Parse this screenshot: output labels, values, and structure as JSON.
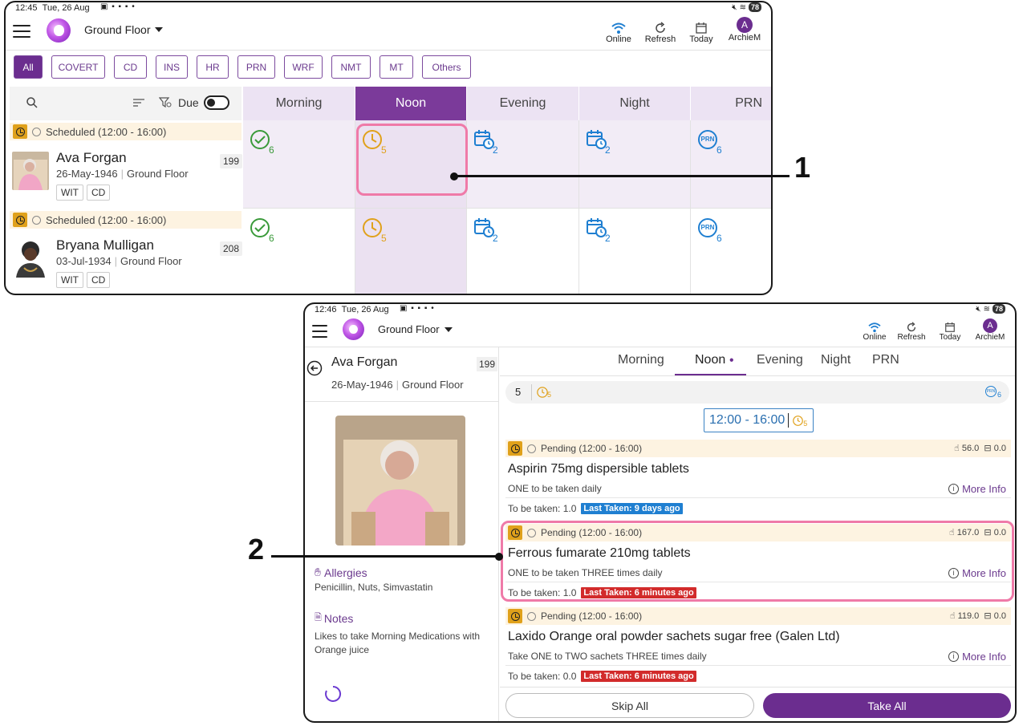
{
  "screen1": {
    "status": {
      "time": "12:45",
      "date": "Tue, 26 Aug",
      "battery": "78"
    },
    "header": {
      "floor": "Ground Floor",
      "actions": [
        {
          "label": "Online"
        },
        {
          "label": "Refresh"
        },
        {
          "label": "Today"
        },
        {
          "label": "ArchieM",
          "initial": "A"
        }
      ]
    },
    "filters": [
      "All",
      "COVERT",
      "CD",
      "INS",
      "HR",
      "PRN",
      "WRF",
      "NMT",
      "MT",
      "Others"
    ],
    "toolbar": {
      "due_label": "Due"
    },
    "columns": [
      "Morning",
      "Noon",
      "Evening",
      "Night",
      "PRN"
    ],
    "patients": [
      {
        "schedule": "Scheduled (12:00 - 16:00)",
        "name": "Ava Forgan",
        "dob": "26-May-1946",
        "floor": "Ground Floor",
        "room": "199",
        "tags": [
          "WIT",
          "CD"
        ],
        "counts": [
          "6",
          "5",
          "2",
          "2",
          "6"
        ]
      },
      {
        "schedule": "Scheduled (12:00 - 16:00)",
        "name": "Bryana Mulligan",
        "dob": "03-Jul-1934",
        "floor": "Ground Floor",
        "room": "208",
        "tags": [
          "WIT",
          "CD"
        ],
        "counts": [
          "6",
          "5",
          "2",
          "2",
          "6"
        ]
      }
    ],
    "prn_icon_text": "PRN",
    "annotation": "1"
  },
  "screen2": {
    "status": {
      "time": "12:46",
      "date": "Tue, 26 Aug",
      "battery": "78"
    },
    "header": {
      "floor": "Ground Floor",
      "actions": [
        {
          "label": "Online"
        },
        {
          "label": "Refresh"
        },
        {
          "label": "Today"
        },
        {
          "label": "ArchieM",
          "initial": "A"
        }
      ]
    },
    "patient": {
      "name": "Ava Forgan",
      "room": "199",
      "dob": "26-May-1946",
      "floor": "Ground Floor",
      "allergies_label": "Allergies",
      "allergies": "Penicillin, Nuts, Simvastatin",
      "notes_label": "Notes",
      "notes": "Likes to take Morning Medications with Orange juice"
    },
    "tabs": [
      "Morning",
      "Noon",
      "Evening",
      "Night",
      "PRN"
    ],
    "summary": {
      "count": "5",
      "clock_count": "5",
      "prn_count": "6"
    },
    "time_slot": {
      "label": "12:00 - 16:00",
      "count": "5"
    },
    "meds": [
      {
        "status": "Pending (12:00 - 16:00)",
        "stock": "56.0",
        "extra": "0.0",
        "name": "Aspirin 75mg dispersible tablets",
        "directions": "ONE to be taken daily",
        "more": "More Info",
        "to_be_taken": "To be taken: 1.0",
        "last_taken": "Last Taken: 9 days ago",
        "last_color": "blue"
      },
      {
        "status": "Pending (12:00 - 16:00)",
        "stock": "167.0",
        "extra": "0.0",
        "name": "Ferrous fumarate 210mg tablets",
        "directions": "ONE to be taken THREE times daily",
        "more": "More Info",
        "to_be_taken": "To be taken: 1.0",
        "last_taken": "Last Taken: 6 minutes ago",
        "last_color": "red"
      },
      {
        "status": "Pending (12:00 - 16:00)",
        "stock": "119.0",
        "extra": "0.0",
        "name": "Laxido Orange oral powder sachets sugar free (Galen Ltd)",
        "directions": "Take ONE to TWO sachets THREE times daily",
        "more": "More Info",
        "to_be_taken": "To be taken: 0.0",
        "last_taken": "Last Taken: 6 minutes ago",
        "last_color": "red"
      }
    ],
    "buttons": {
      "skip": "Skip All",
      "take": "Take All"
    },
    "annotation": "2"
  }
}
